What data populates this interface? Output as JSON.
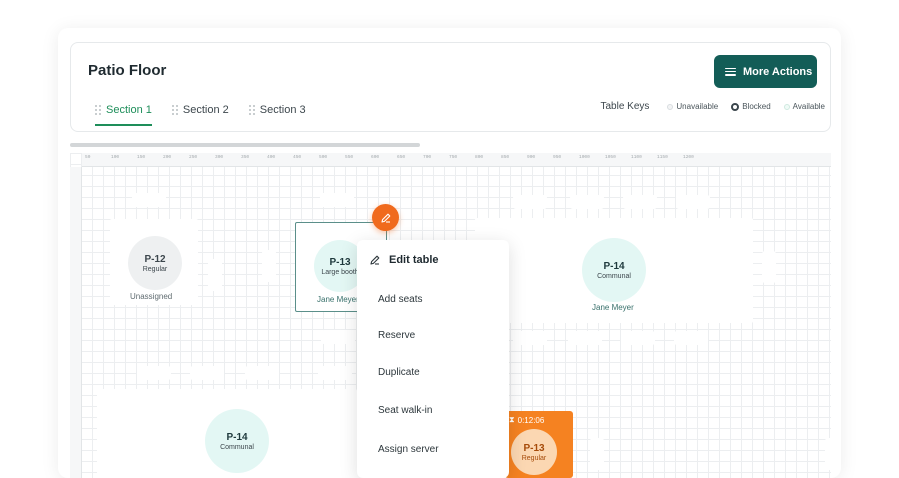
{
  "header": {
    "title": "Patio Floor",
    "more_actions_label": "More Actions",
    "tabs": [
      {
        "label": "Section 1",
        "active": true
      },
      {
        "label": "Section 2",
        "active": false
      },
      {
        "label": "Section 3",
        "active": false
      }
    ],
    "table_keys": {
      "title": "Table Keys",
      "items": [
        {
          "label": "Unavailable",
          "icon": "unavailable-dot-icon"
        },
        {
          "label": "Blocked",
          "icon": "blocked-ring-icon"
        },
        {
          "label": "Available",
          "icon": "available-dot-icon"
        }
      ]
    }
  },
  "ruler": {
    "labels": [
      "50",
      "100",
      "150",
      "200",
      "250",
      "300",
      "350",
      "400",
      "450",
      "500",
      "550",
      "600",
      "650",
      "700",
      "750",
      "800",
      "850",
      "900",
      "950",
      "1000",
      "1050",
      "1100",
      "1150",
      "1200"
    ]
  },
  "tables": [
    {
      "id": "P-12",
      "type": "Regular",
      "server": "Unassigned"
    },
    {
      "id": "P-13",
      "type": "Large booth",
      "server": "Jane Meyer"
    },
    {
      "id": "P-14",
      "type": "Communal",
      "server": "Jane Meyer"
    },
    {
      "id": "P-14",
      "type": "Communal",
      "server": ""
    },
    {
      "id": "P-13",
      "type": "Regular",
      "timer": "0:12:06"
    }
  ],
  "context_menu": {
    "title": "Edit table",
    "items": [
      "Add seats",
      "Reserve",
      "Duplicate",
      "Seat walk-in",
      "Assign server"
    ]
  },
  "colors": {
    "primary": "#135d57",
    "accent_green": "#1e8e5a",
    "orange": "#f06a1d",
    "orange_card": "#f58221",
    "table_circle": "#e3f7f4"
  }
}
